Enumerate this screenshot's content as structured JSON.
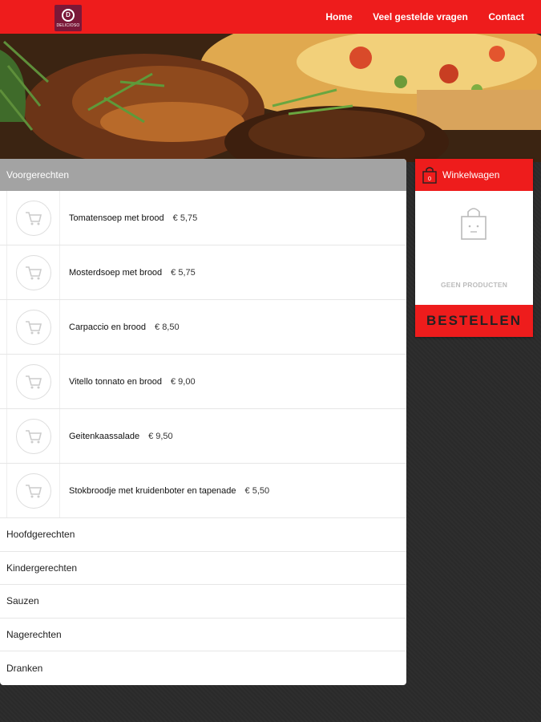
{
  "brand": {
    "logo_text": "DELICIOSO",
    "accent": "#ee1c1c"
  },
  "nav": [
    {
      "label": "Home"
    },
    {
      "label": "Veel gestelde vragen"
    },
    {
      "label": "Contact"
    }
  ],
  "menu": {
    "active_category": "Voorgerechten",
    "items": [
      {
        "name": "Tomatensoep met brood",
        "price": "€ 5,75",
        "icon": "cart-icon"
      },
      {
        "name": "Mosterdsoep met brood",
        "price": "€ 5,75",
        "icon": "cart-icon"
      },
      {
        "name": "Carpaccio en brood",
        "price": "€ 8,50",
        "icon": "cart-icon"
      },
      {
        "name": "Vitello tonnato en brood",
        "price": "€ 9,00",
        "icon": "cart-icon"
      },
      {
        "name": "Geitenkaassalade",
        "price": "€ 9,50",
        "icon": "cart-icon"
      },
      {
        "name": "Stokbroodje met kruidenboter en tapenade",
        "price": "€ 5,50",
        "icon": "cart-icon"
      }
    ],
    "other_categories": [
      "Hoofdgerechten",
      "Kindergerechten",
      "Sauzen",
      "Nagerechten",
      "Dranken"
    ]
  },
  "cart": {
    "title": "Winkelwagen",
    "empty_text": "GEEN PRODUCTEN",
    "order_label": "BESTELLEN"
  }
}
